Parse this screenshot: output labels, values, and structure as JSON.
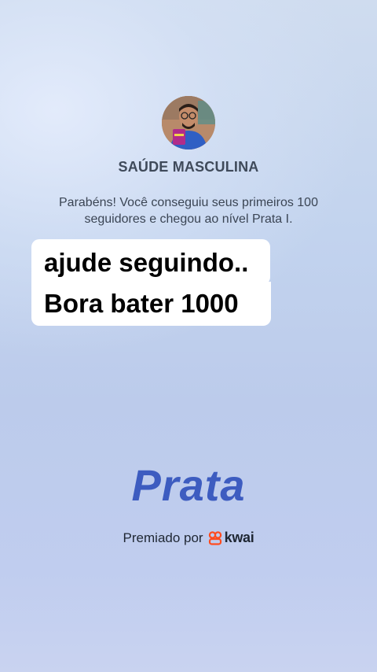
{
  "profile": {
    "name": "SAÚDE MASCULINA",
    "message": "Parabéns! Você conseguiu seus primeiros 100 seguidores e chegou ao nível Prata I."
  },
  "overlay": {
    "line1": "ajude seguindo..",
    "line2": "Bora bater 1000"
  },
  "tier": {
    "label": "Prata"
  },
  "footer": {
    "awarded_by": "Premiado por",
    "brand": "kwai",
    "brand_icon": "kwai-logo-icon",
    "brand_color": "#ff4b1f"
  }
}
